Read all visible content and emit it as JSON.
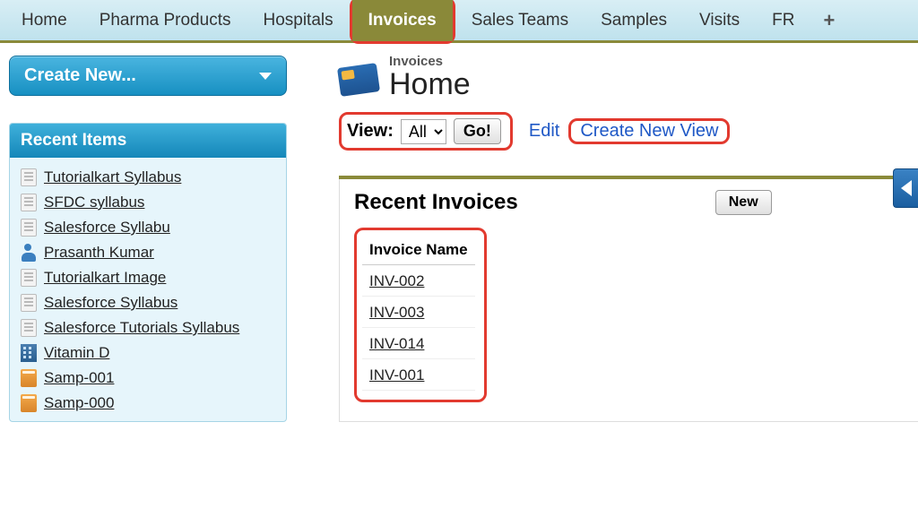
{
  "tabs": {
    "items": [
      {
        "label": "Home",
        "active": false
      },
      {
        "label": "Pharma Products",
        "active": false
      },
      {
        "label": "Hospitals",
        "active": false
      },
      {
        "label": "Invoices",
        "active": true
      },
      {
        "label": "Sales Teams",
        "active": false
      },
      {
        "label": "Samples",
        "active": false
      },
      {
        "label": "Visits",
        "active": false
      },
      {
        "label": "FR",
        "active": false
      }
    ],
    "plus": "+"
  },
  "sidebar": {
    "create_new_label": "Create New...",
    "recent_header": "Recent Items",
    "recent_items": [
      {
        "icon": "doc",
        "label": "Tutorialkart Syllabus"
      },
      {
        "icon": "doc",
        "label": "SFDC syllabus"
      },
      {
        "icon": "doc",
        "label": "Salesforce Syllabu"
      },
      {
        "icon": "person",
        "label": "Prasanth Kumar"
      },
      {
        "icon": "doc",
        "label": "Tutorialkart Image"
      },
      {
        "icon": "doc",
        "label": "Salesforce Syllabus"
      },
      {
        "icon": "doc",
        "label": "Salesforce Tutorials Syllabus"
      },
      {
        "icon": "building",
        "label": "Vitamin D"
      },
      {
        "icon": "book",
        "label": "Samp-001"
      },
      {
        "icon": "book",
        "label": "Samp-000"
      }
    ]
  },
  "main": {
    "breadcrumb": "Invoices",
    "title": "Home",
    "view_label": "View:",
    "view_selected": "All",
    "go_label": "Go!",
    "edit_label": "Edit",
    "create_view_label": "Create New View",
    "recent_panel_title": "Recent Invoices",
    "new_label": "New",
    "invoice_header": "Invoice Name",
    "invoices": [
      {
        "name": "INV-002"
      },
      {
        "name": "INV-003"
      },
      {
        "name": "INV-014"
      },
      {
        "name": "INV-001"
      }
    ]
  }
}
